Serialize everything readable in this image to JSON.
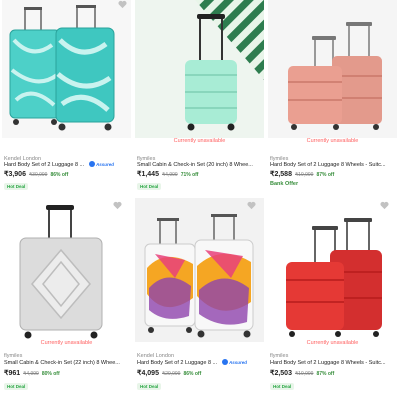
{
  "labels": {
    "currently_unavailable": "Currently unavailable",
    "hot_deal": "Hot Deal",
    "bank_offer": "Bank Offer",
    "assured": "Assured"
  },
  "colors": {
    "discount_green": "#388e3c",
    "unavailable_red": "#ff6161",
    "assured_blue": "#2874f0"
  },
  "products": [
    {
      "brand": "Kendel London",
      "title": "Hard Body Set of 2 Luggage 8 ...",
      "price": "₹3,906",
      "mrp": "₹30,999",
      "off": "86% off",
      "assured": true,
      "unavailable": false,
      "badge": "Hot Deal",
      "image": "teal-suitcase-set"
    },
    {
      "brand": "flymiles",
      "title": "Small Cabin & Check-in Set (20 inch) 8 Whee...",
      "price": "₹1,445",
      "mrp": "₹4,999",
      "off": "71% off",
      "assured": false,
      "unavailable": true,
      "badge": "Hot Deal",
      "image": "mint-cabin-suitcase"
    },
    {
      "brand": "flymiles",
      "title": "Hard Body Set of 2 Luggage 8 Wheels - Suitc...",
      "price": "₹2,588",
      "mrp": "₹19,999",
      "off": "87% off",
      "assured": false,
      "unavailable": true,
      "bank_offer": true,
      "image": "peach-suitcase-set"
    },
    {
      "brand": "flymiles",
      "title": "Small Cabin & Check-in Set (22 inch) 8 Whee...",
      "price": "₹961",
      "mrp": "₹4,999",
      "off": "80% off",
      "assured": false,
      "unavailable": true,
      "badge": "Hot Deal",
      "image": "silver-cabin-suitcase"
    },
    {
      "brand": "Kendel London",
      "title": "Hard Body Set of 2 Luggage 8 ...",
      "price": "₹4,095",
      "mrp": "₹29,999",
      "off": "86% off",
      "assured": true,
      "unavailable": false,
      "badge": "Hot Deal",
      "image": "pattern-suitcase-set"
    },
    {
      "brand": "flymiles",
      "title": "Hard Body Set of 2 Luggage 8 Wheels - Suitc...",
      "price": "₹2,503",
      "mrp": "₹19,999",
      "off": "87% off",
      "assured": false,
      "unavailable": true,
      "badge": "Hot Deal",
      "image": "red-suitcase-set"
    }
  ]
}
